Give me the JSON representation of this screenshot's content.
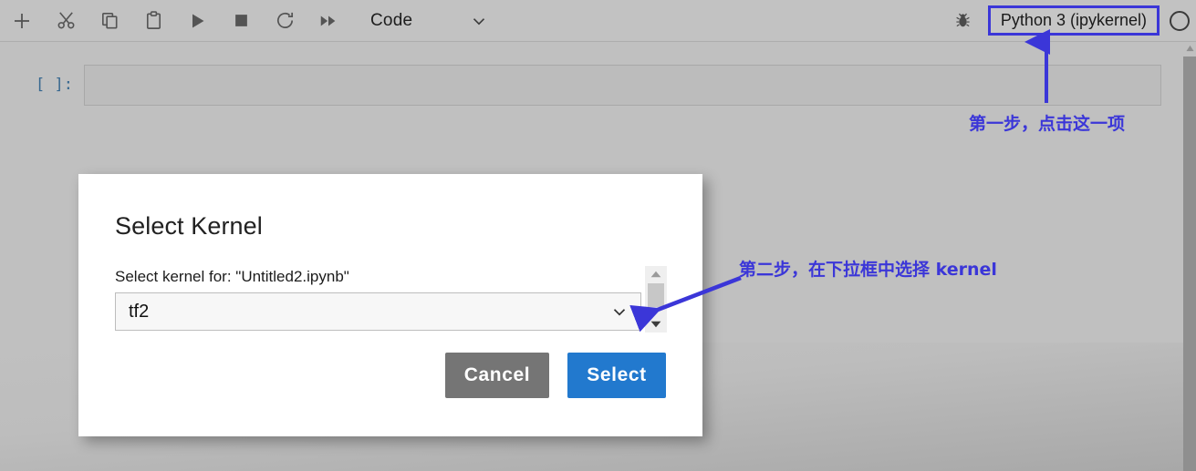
{
  "toolbar": {
    "buttons": [
      {
        "name": "add-cell-icon",
        "title": "Insert a cell below"
      },
      {
        "name": "cut-icon",
        "title": "Cut this cell"
      },
      {
        "name": "copy-icon",
        "title": "Copy this cell"
      },
      {
        "name": "paste-icon",
        "title": "Paste cells from the clipboard"
      },
      {
        "name": "run-icon",
        "title": "Run the selected cells and advance"
      },
      {
        "name": "stop-icon",
        "title": "Interrupt the kernel"
      },
      {
        "name": "restart-icon",
        "title": "Restart the kernel"
      },
      {
        "name": "restart-run-all-icon",
        "title": "Restart the kernel and run all cells"
      }
    ],
    "cell_type": "Code",
    "cell_type_chevron": "chevron-down-icon",
    "debug_icon": "bug-icon",
    "kernel_name": "Python 3 (ipykernel)",
    "kernel_status": "idle-circle-icon",
    "highlight_color": "#3b36d8"
  },
  "notebook": {
    "cell_prompt": "[ ]:",
    "cell_content": ""
  },
  "scrollbar": {
    "up_arrow": "triangle-up-icon",
    "thumb": "scroll-thumb"
  },
  "dialog": {
    "title": "Select Kernel",
    "body_label": "Select kernel for: \"Untitled2.ipynb\"",
    "selected_kernel": "tf2",
    "select_chevron": "chevron-down-icon",
    "scroll_up": "triangle-up-icon",
    "scroll_down": "triangle-down-icon",
    "cancel_label": "Cancel",
    "select_label": "Select",
    "cancel_color": "#757575",
    "select_color": "#2279ce"
  },
  "annotations": {
    "step1": "第一步，点击这一项",
    "step2": "第二步，在下拉框中选择 kernel",
    "color": "#3b36d8"
  }
}
